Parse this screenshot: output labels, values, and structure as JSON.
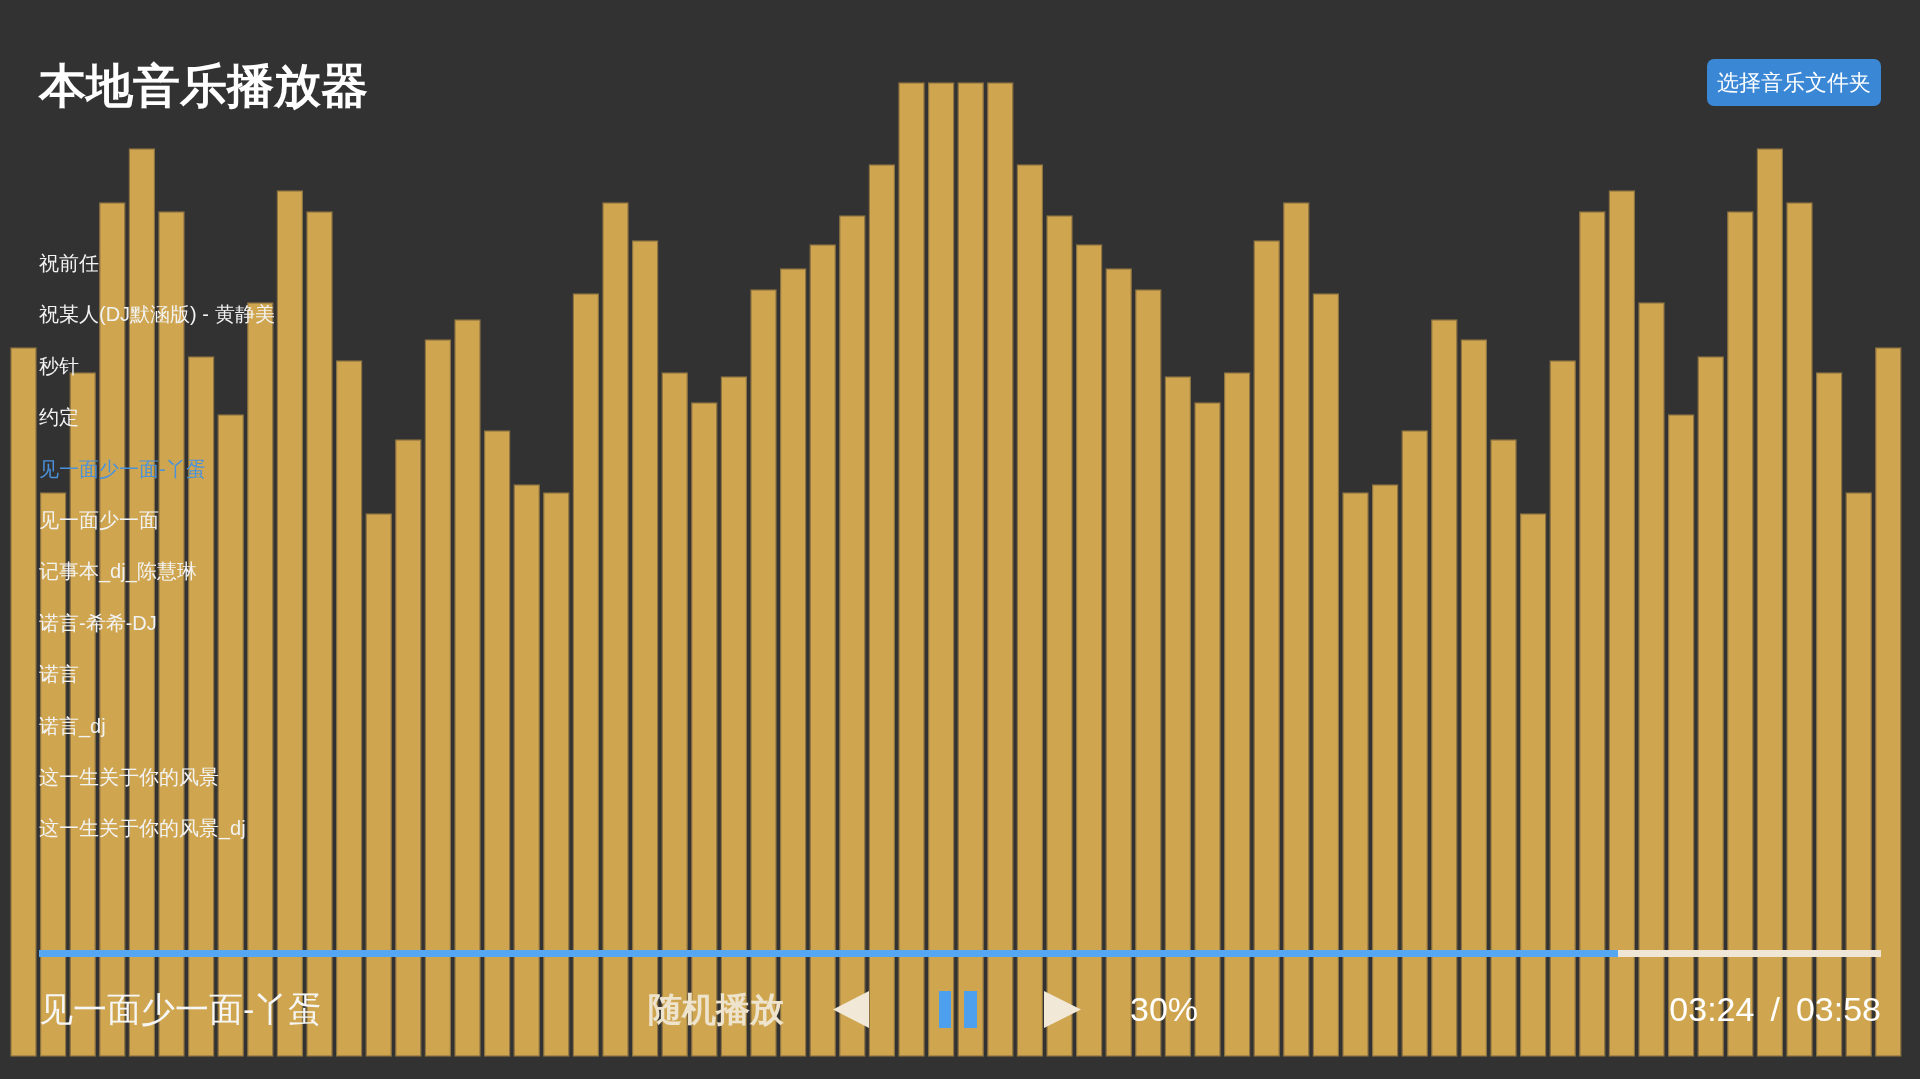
{
  "header": {
    "title": "本地音乐播放器",
    "folder_button": "选择音乐文件夹"
  },
  "playlist": [
    {
      "title": "祝前任",
      "selected": false
    },
    {
      "title": "祝某人(DJ默涵版) - 黄静美",
      "selected": false
    },
    {
      "title": "秒针",
      "selected": false
    },
    {
      "title": "约定",
      "selected": false
    },
    {
      "title": "见一面少一面-丫蛋",
      "selected": true
    },
    {
      "title": "见一面少一面",
      "selected": false
    },
    {
      "title": "记事本_dj_陈慧琳",
      "selected": false
    },
    {
      "title": "诺言-希希-DJ",
      "selected": false
    },
    {
      "title": "诺言",
      "selected": false
    },
    {
      "title": "诺言_dj",
      "selected": false
    },
    {
      "title": "这一生关于你的风景",
      "selected": false
    },
    {
      "title": "这一生关于你的风景_dj",
      "selected": false
    }
  ],
  "progress": {
    "level": 0.857
  },
  "player": {
    "now_playing": "见一面少一面-丫蛋",
    "mode": "随机播放",
    "playing": true,
    "volume": "30%",
    "elapsed": "03:24",
    "separator": "/",
    "duration": "03:58"
  }
}
